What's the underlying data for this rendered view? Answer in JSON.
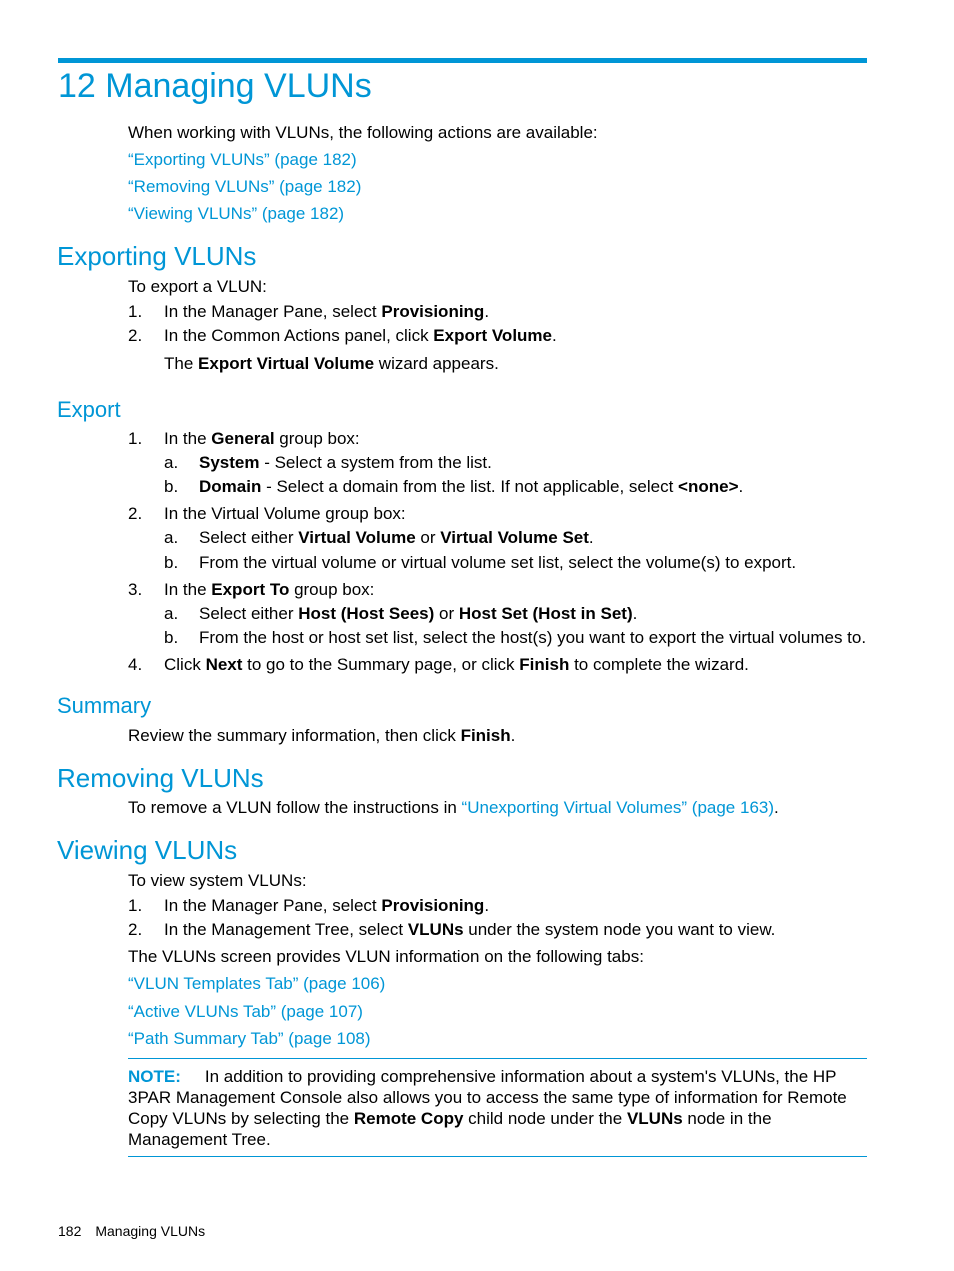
{
  "chapter_title": "12 Managing VLUNs",
  "intro": "When working with VLUNs, the following actions are available:",
  "intro_links": [
    "“Exporting VLUNs” (page 182)",
    "“Removing VLUNs” (page 182)",
    "“Viewing VLUNs” (page 182)"
  ],
  "exporting": {
    "heading": "Exporting VLUNs",
    "lead": "To export a VLUN:",
    "steps": [
      {
        "num": "1.",
        "pre": "In the Manager Pane, select ",
        "bold": "Provisioning",
        "post": "."
      },
      {
        "num": "2.",
        "pre": "In the Common Actions panel, click ",
        "bold": "Export Volume",
        "post": "."
      }
    ],
    "result": {
      "pre": "The ",
      "bold": "Export Virtual Volume",
      "post": " wizard appears."
    }
  },
  "export": {
    "heading": "Export",
    "s1": {
      "num": "1.",
      "pre": "In the ",
      "bold": "General",
      "post": " group box:"
    },
    "s1a": {
      "let": "a.",
      "bold": "System",
      "post": " - Select a system from the list."
    },
    "s1b": {
      "let": "b.",
      "bold": "Domain",
      "mid": " - Select a domain from the list. If not applicable, select ",
      "bold2": "<none>",
      "post": "."
    },
    "s2": {
      "num": "2.",
      "text": "In the Virtual Volume group box:"
    },
    "s2a": {
      "let": "a.",
      "pre": "Select either ",
      "bold": "Virtual Volume",
      "mid": " or ",
      "bold2": "Virtual Volume Set",
      "post": "."
    },
    "s2b": {
      "let": "b.",
      "text": "From the virtual volume or virtual volume set list, select the volume(s) to export."
    },
    "s3": {
      "num": "3.",
      "pre": "In the ",
      "bold": "Export To",
      "post": " group box:"
    },
    "s3a": {
      "let": "a.",
      "pre": "Select either ",
      "bold": "Host (Host Sees)",
      "mid": " or ",
      "bold2": "Host Set (Host in Set)",
      "post": "."
    },
    "s3b": {
      "let": "b.",
      "text": "From the host or host set list, select the host(s) you want to export the virtual volumes to."
    },
    "s4": {
      "num": "4.",
      "pre": "Click ",
      "bold": "Next",
      "mid": " to go to the Summary page, or click ",
      "bold2": "Finish",
      "post": " to complete the wizard."
    }
  },
  "summary": {
    "heading": "Summary",
    "pre": "Review the summary information, then click ",
    "bold": "Finish",
    "post": "."
  },
  "removing": {
    "heading": "Removing VLUNs",
    "pre": "To remove a VLUN follow the instructions in ",
    "link": "“Unexporting Virtual Volumes” (page 163)",
    "post": "."
  },
  "viewing": {
    "heading": "Viewing VLUNs",
    "lead": "To view system VLUNs:",
    "steps": [
      {
        "num": "1.",
        "pre": "In the Manager Pane, select ",
        "bold": "Provisioning",
        "post": "."
      },
      {
        "num": "2.",
        "pre": "In the Management Tree, select ",
        "bold": "VLUNs",
        "post": " under the system node you want to view."
      }
    ],
    "tabs_intro": "The VLUNs screen provides VLUN information on the following tabs:",
    "tab_links": [
      "“VLUN Templates Tab” (page 106)",
      "“Active VLUNs Tab” (page 107)",
      "“Path Summary Tab” (page 108)"
    ]
  },
  "note": {
    "label": "NOTE:",
    "t1": "In addition to providing comprehensive information about a system's VLUNs, the HP 3PAR Management Console also allows you to access the same type of information for Remote Copy VLUNs by selecting the ",
    "b1": "Remote Copy",
    "t2": " child node under the ",
    "b2": "VLUNs",
    "t3": " node in the Management Tree."
  },
  "footer": {
    "page_number": "182",
    "section": "Managing VLUNs"
  }
}
